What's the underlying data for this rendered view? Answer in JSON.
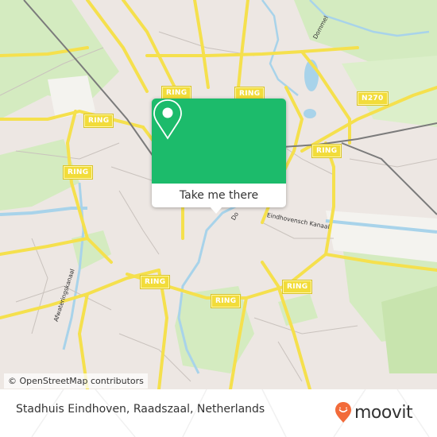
{
  "map": {
    "ring_label": "RING",
    "highway_label": "N270",
    "streets": {
      "dommel": "Dommel",
      "kanaal": "Eindhovensch Kanaal",
      "afwatering": "Afwateringskanaal",
      "dommel_center": "Do"
    },
    "attribution": "© OpenStreetMap contributors",
    "colors": {
      "background": "#ede7e3",
      "park": "#cde8b4",
      "water": "#a8d3ea",
      "road_major": "#f5e04d",
      "rail": "#777777"
    }
  },
  "popup": {
    "icon": "location-pin-icon",
    "button_label": "Take me there",
    "color": "#1cbb6b"
  },
  "footer": {
    "location_title": "Stadhuis Eindhoven, Raadszaal, Netherlands",
    "brand": "moovit",
    "brand_color": "#f26b3a"
  }
}
